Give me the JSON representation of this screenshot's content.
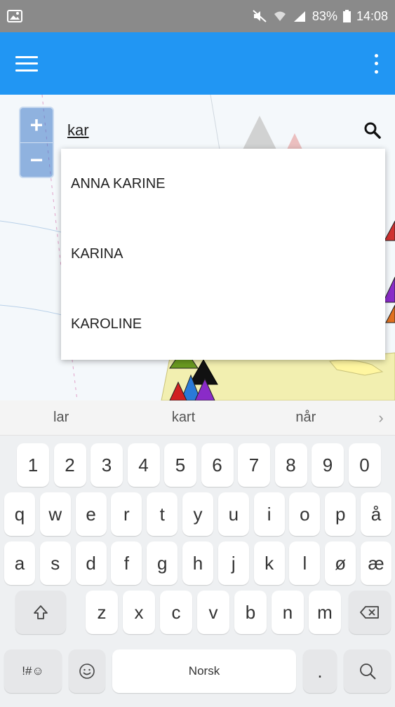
{
  "status_bar": {
    "battery": "83%",
    "time": "14:08"
  },
  "search": {
    "value": "kar",
    "placeholder": ""
  },
  "suggestions": [
    "ANNA KARINE",
    "KARINA",
    "KAROLINE"
  ],
  "keyboard": {
    "predictions": [
      "lar",
      "kart",
      "når"
    ],
    "row_numbers": [
      "1",
      "2",
      "3",
      "4",
      "5",
      "6",
      "7",
      "8",
      "9",
      "0"
    ],
    "row1": [
      "q",
      "w",
      "e",
      "r",
      "t",
      "y",
      "u",
      "i",
      "o",
      "p",
      "å"
    ],
    "row2": [
      "a",
      "s",
      "d",
      "f",
      "g",
      "h",
      "j",
      "k",
      "l",
      "ø",
      "æ"
    ],
    "row3": [
      "z",
      "x",
      "c",
      "v",
      "b",
      "n",
      "m"
    ],
    "symbols_label": "!#☺",
    "space_label": "Norsk",
    "period_label": "."
  },
  "colors": {
    "app_bar": "#2196f3",
    "status_bar": "#8a8a8a"
  },
  "icons": {
    "menu": "hamburger-icon",
    "overflow": "more-vert-icon",
    "search": "search-icon",
    "zoom_in": "plus-icon",
    "zoom_out": "minus-icon"
  }
}
